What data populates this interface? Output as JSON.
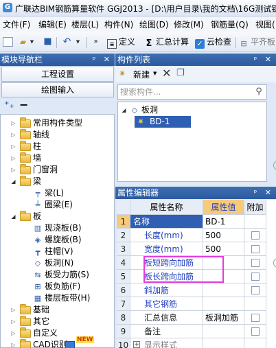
{
  "window": {
    "title": "广联达BIM钢筋算量软件 GGJ2013 - [D:\\用户目录\\我的文档\\16G测试钢"
  },
  "menu": [
    "文件(F)",
    "编辑(E)",
    "楼层(L)",
    "构件(N)",
    "绘图(D)",
    "修改(M)",
    "钢筋量(Q)",
    "视图("
  ],
  "toolbar": {
    "define": "定义",
    "summary": "汇总计算",
    "cloud_check": "云检查",
    "flat_top": "平齐板"
  },
  "nav_panel": {
    "title": "模块导航栏",
    "buttons": [
      "工程设置",
      "绘图输入"
    ],
    "tree": {
      "common": "常用构件类型",
      "axis": "轴线",
      "column": "柱",
      "wall": "墙",
      "door": "门窗洞",
      "beam": "梁",
      "beam_children": [
        "梁(L)",
        "圈梁(E)"
      ],
      "slab": "板",
      "slab_children": [
        "现浇板(B)",
        "螺旋板(B)",
        "柱帽(V)",
        "板洞(N)",
        "板受力筋(S)",
        "板负筋(F)",
        "楼层板带(H)"
      ],
      "foundation": "基础",
      "other": "其它",
      "custom": "自定义",
      "cad": "CAD识别",
      "new_badge": "NEW"
    }
  },
  "component_list": {
    "title": "构件列表",
    "new_label": "新建",
    "search_placeholder": "搜索构件...",
    "tree": {
      "parent": "板洞",
      "child": "BD-1"
    }
  },
  "attr_editor": {
    "title": "属性编辑器",
    "headers": {
      "name": "属性名称",
      "value": "属性值",
      "extra": "附加"
    },
    "rows": [
      {
        "num": "1",
        "name": "名称",
        "value": "BD-1"
      },
      {
        "num": "2",
        "name": "长度(mm)",
        "value": "500"
      },
      {
        "num": "3",
        "name": "宽度(mm)",
        "value": "500"
      },
      {
        "num": "4",
        "name": "板短跨向加筋",
        "value": ""
      },
      {
        "num": "5",
        "name": "板长跨向加筋",
        "value": ""
      },
      {
        "num": "6",
        "name": "斜加筋",
        "value": ""
      },
      {
        "num": "7",
        "name": "其它钢筋",
        "value": ""
      },
      {
        "num": "8",
        "name": "汇总信息",
        "value": "板洞加筋"
      },
      {
        "num": "9",
        "name": "备注",
        "value": ""
      },
      {
        "num": "10",
        "name": "显示样式",
        "value": ""
      }
    ]
  },
  "colors": {
    "panel_header": "#2c5aa0",
    "highlight_box": "#e23ce0",
    "value_header": "#f7c97a",
    "link_text": "#1f3fbf"
  }
}
